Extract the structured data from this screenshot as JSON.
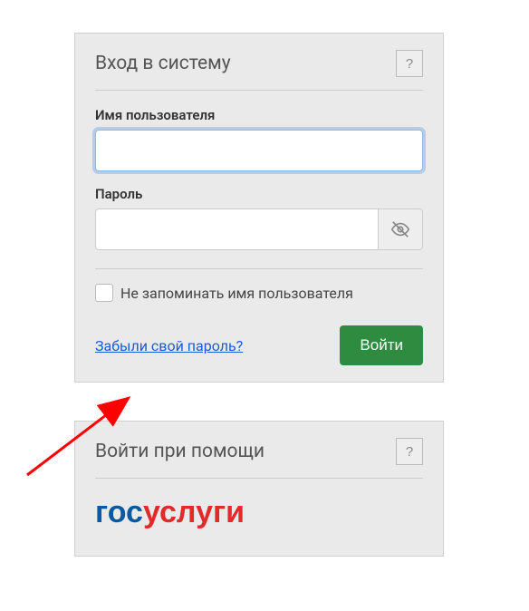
{
  "login_panel": {
    "title": "Вход в систему",
    "help_label": "?",
    "username_label": "Имя пользователя",
    "username_value": "",
    "password_label": "Пароль",
    "password_value": "",
    "remember_label": "Не запоминать имя пользователя",
    "forgot_link": "Забыли свой пароль?",
    "submit_label": "Войти"
  },
  "alt_panel": {
    "title": "Войти при помощи",
    "help_label": "?",
    "gosuslugi_part1": "гос",
    "gosuslugi_part2": "услуги"
  }
}
